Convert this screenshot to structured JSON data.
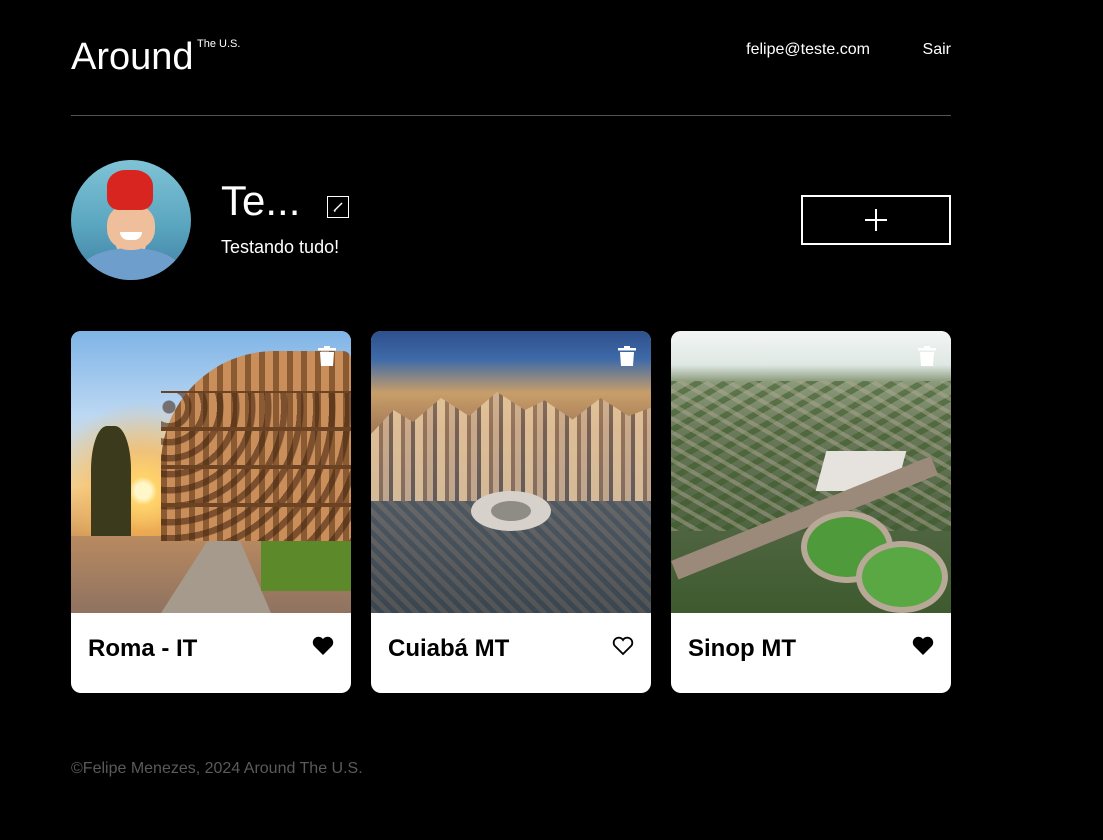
{
  "header": {
    "logo": "Around",
    "logo_sup": "The U.S.",
    "email": "felipe@teste.com",
    "logout": "Sair"
  },
  "profile": {
    "name": "Te...",
    "about": "Testando tudo!"
  },
  "cards": [
    {
      "title": "Roma - IT",
      "liked": true
    },
    {
      "title": "Cuiabá MT",
      "liked": false
    },
    {
      "title": "Sinop MT",
      "liked": true
    }
  ],
  "footer": {
    "text": "©Felipe Menezes, 2024 Around The U.S."
  },
  "colors": {
    "background": "#000000",
    "card": "#ffffff",
    "footer_text": "#5a5a5a"
  }
}
